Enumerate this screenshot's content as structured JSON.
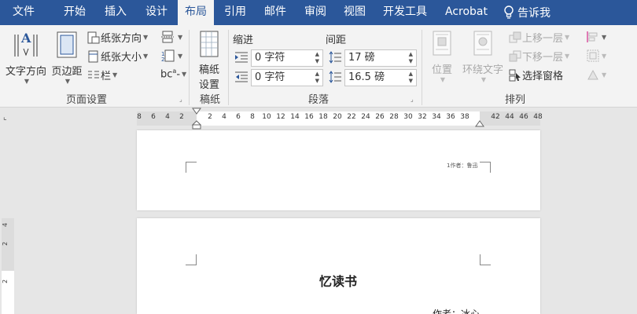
{
  "menubar": {
    "tabs": [
      {
        "label": "文件"
      },
      {
        "label": "开始"
      },
      {
        "label": "插入"
      },
      {
        "label": "设计"
      },
      {
        "label": "布局"
      },
      {
        "label": "引用"
      },
      {
        "label": "邮件"
      },
      {
        "label": "审阅"
      },
      {
        "label": "视图"
      },
      {
        "label": "开发工具"
      },
      {
        "label": "Acrobat"
      }
    ],
    "active_tab": "布局",
    "tell_me": "告诉我"
  },
  "ribbon": {
    "page_setup": {
      "label": "页面设置",
      "text_direction": "文字方向",
      "margins": "页边距",
      "orientation": "纸张方向",
      "size": "纸张大小",
      "columns": "栏"
    },
    "manuscript": {
      "label": "稿纸",
      "settings_line1": "稿纸",
      "settings_line2": "设置"
    },
    "paragraph": {
      "label": "段落",
      "indent_label": "缩进",
      "spacing_label": "间距",
      "indent_left": "0 字符",
      "indent_right": "0 字符",
      "spacing_before": "17 磅",
      "spacing_after": "16.5 磅"
    },
    "arrange": {
      "label": "排列",
      "position": "位置",
      "wrap_text": "环绕文字",
      "bring_forward": "上移一层",
      "send_backward": "下移一层",
      "selection_pane": "选择窗格"
    }
  },
  "ruler": {
    "left_ticks": [
      "8",
      "6",
      "4",
      "2"
    ],
    "right_ticks": [
      "2",
      "4",
      "6",
      "8",
      "10",
      "12",
      "14",
      "16",
      "18",
      "20",
      "22",
      "24",
      "26",
      "28",
      "30",
      "32",
      "34",
      "36",
      "38"
    ],
    "far_ticks": [
      "42",
      "44",
      "46",
      "48"
    ],
    "vertical_ticks": [
      "4",
      "2",
      "2"
    ]
  },
  "document": {
    "header_text": "1作者：鲁迅",
    "title": "忆读书",
    "author": "作者：冰心"
  },
  "colors": {
    "accent": "#2b579a",
    "ribbon_bg": "#f3f3f3",
    "canvas_bg": "#e6e6e6"
  }
}
